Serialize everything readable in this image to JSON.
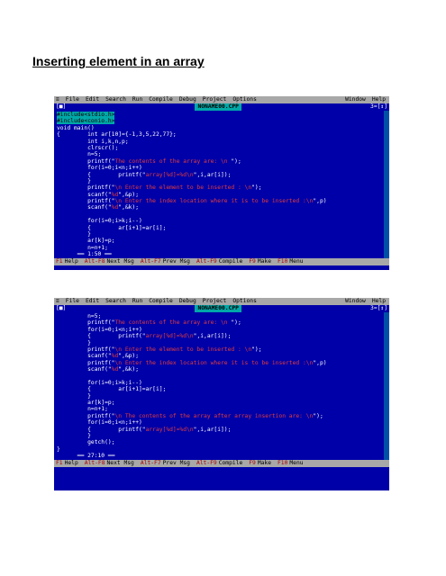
{
  "page_title": "Inserting element in an array",
  "menu": {
    "system": "≡",
    "items": [
      "File",
      "Edit",
      "Search",
      "Run",
      "Compile",
      "Debug",
      "Project",
      "Options"
    ],
    "right_items": [
      "Window",
      "Help"
    ]
  },
  "editor": {
    "window_left": "[■]",
    "window_right": "3=[↕]",
    "filename": "NONAME00.CPP"
  },
  "screen1": {
    "lines": [
      "#include<stdio.h>",
      "#include<conio.h>",
      "void main()",
      "{        int ar[10]={-1,3,5,22,77};",
      "         int i,k,n,p;",
      "         clrscr();",
      "         n=5;",
      "         printf(\"The contents of the array are: \\n \");",
      "         for(i=0;i<n;i++)",
      "         {        printf(\"array[%d]=%d\\n\",i,ar[i]);",
      "         }",
      "         printf(\"\\n Enter the element to be inserted : \\n\");",
      "         scanf(\"%d\",&p);",
      "         printf(\"\\n Enter the index location where it is to be inserted :\\n\",p)",
      "         scanf(\"%d\",&k);",
      "",
      "         for(i=0;i>k;i--)",
      "         {        ar[i+1]=ar[i];",
      "         }",
      "         ar[k]=p;",
      "         n=n+1;"
    ],
    "cursor": "1:50"
  },
  "screen2": {
    "lines": [
      "         n=5;",
      "         printf(\"The contents of the array are: \\n \");",
      "         for(i=0;i<n;i++)",
      "         {        printf(\"array[%d]=%d\\n\",i,ar[i]);",
      "         }",
      "         printf(\"\\n Enter the element to be inserted : \\n\");",
      "         scanf(\"%d\",&p);",
      "         printf(\"\\n Enter the index location where it is to be inserted :\\n\",p)",
      "         scanf(\"%d\",&k);",
      "",
      "         for(i=0;i>k;i--)",
      "         {        ar[i+1]=ar[i];",
      "         }",
      "         ar[k]=p;",
      "         n=n+1;",
      "         printf(\"\\n The contents of the array after array insertion are: \\n\");",
      "         for(i=0;i<n;i++)",
      "         {        printf(\"array[%d]=%d\\n\",i,ar[i]);",
      "         }",
      "         getch();",
      "}"
    ],
    "cursor": "27:10"
  },
  "status": [
    {
      "key": "F1",
      "label": "Help"
    },
    {
      "key": "Alt-F8",
      "label": "Next Msg"
    },
    {
      "key": "Alt-F7",
      "label": "Prev Msg"
    },
    {
      "key": "Alt-F9",
      "label": "Compile"
    },
    {
      "key": "F9",
      "label": "Make"
    },
    {
      "key": "F10",
      "label": "Menu"
    }
  ],
  "colors": {
    "background": "#0000a8",
    "bars": "#a8a8a8",
    "selection": "#00a8a8",
    "string": "#e23c3c"
  }
}
